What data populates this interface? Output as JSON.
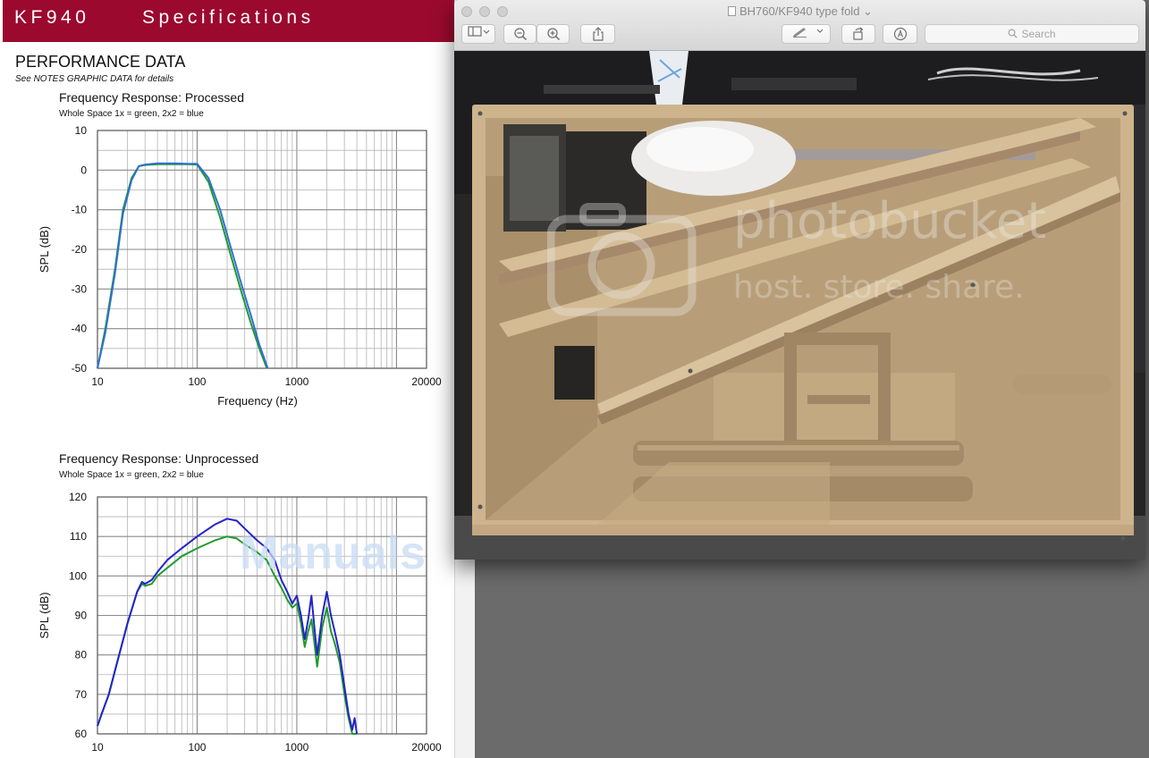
{
  "document": {
    "header": {
      "model": "KF940",
      "title": "Specifications"
    },
    "section_title": "PERFORMANCE DATA",
    "section_note": "See NOTES GRAPHIC DATA for details",
    "watermark": "Manuals"
  },
  "chart_data": [
    {
      "type": "line",
      "title": "Frequency Response: Processed",
      "subtitle": "Whole Space 1x = green, 2x2 = blue",
      "xlabel": "Frequency (Hz)",
      "ylabel": "SPL (dB)",
      "xscale": "log",
      "xlim": [
        10,
        20000
      ],
      "ylim": [
        -50,
        10
      ],
      "xticks": [
        "10",
        "100",
        "1000",
        "20000"
      ],
      "yticks": [
        "10",
        "0",
        "-10",
        "-20",
        "-30",
        "-40",
        "-50"
      ],
      "grid": true,
      "series": [
        {
          "color": "#1f9a2e",
          "x": [
            10,
            12,
            15,
            18,
            22,
            26,
            30,
            40,
            60,
            80,
            100,
            130,
            170,
            220,
            280,
            350,
            420,
            500
          ],
          "y": [
            -50,
            -40,
            -25,
            -10,
            -2,
            1,
            1.3,
            1.5,
            1.5,
            1.5,
            1.4,
            -3,
            -12,
            -22,
            -31,
            -39,
            -45,
            -50
          ]
        },
        {
          "color": "#2f6fd6",
          "x": [
            10,
            12,
            15,
            18,
            22,
            26,
            30,
            40,
            60,
            80,
            100,
            130,
            170,
            220,
            280,
            350,
            420,
            510
          ],
          "y": [
            -50,
            -41,
            -26,
            -11,
            -2.5,
            1,
            1.4,
            1.7,
            1.7,
            1.6,
            1.6,
            -2,
            -10,
            -20,
            -29,
            -37,
            -44,
            -50
          ]
        }
      ]
    },
    {
      "type": "line",
      "title": "Frequency Response: Unprocessed",
      "subtitle": "Whole Space 1x = green, 2x2 = blue",
      "xlabel": "",
      "ylabel": "SPL (dB)",
      "xscale": "log",
      "xlim": [
        10,
        20000
      ],
      "ylim": [
        60,
        120
      ],
      "xticks": [
        "10",
        "100",
        "1000",
        "20000"
      ],
      "yticks": [
        "120",
        "110",
        "100",
        "90",
        "80",
        "70",
        "60"
      ],
      "grid": true,
      "series": [
        {
          "color": "#1f9a2e",
          "x": [
            10,
            11,
            13,
            15,
            20,
            25,
            28,
            30,
            35,
            40,
            50,
            70,
            100,
            150,
            200,
            250,
            300,
            400,
            500,
            600,
            700,
            800,
            900,
            1000,
            1100,
            1200,
            1300,
            1400,
            1500,
            1600,
            1800,
            2000,
            2200,
            2400,
            2700,
            3000,
            3300,
            3600,
            4000
          ],
          "y": [
            62,
            65,
            70,
            76,
            88,
            96,
            98,
            97.5,
            98,
            100,
            102,
            105,
            107,
            109,
            110,
            109.5,
            108,
            106,
            104,
            100,
            97,
            94,
            92,
            93,
            88,
            82,
            86,
            89,
            83,
            77,
            87,
            92,
            86,
            83,
            78,
            70,
            64,
            60,
            60
          ]
        },
        {
          "color": "#2323c9",
          "x": [
            10,
            11,
            13,
            15,
            20,
            25,
            28,
            30,
            35,
            40,
            50,
            70,
            100,
            150,
            200,
            250,
            300,
            400,
            500,
            600,
            700,
            800,
            900,
            1000,
            1100,
            1200,
            1300,
            1400,
            1500,
            1600,
            1800,
            2000,
            2200,
            2400,
            2700,
            3000,
            3300,
            3600,
            3800,
            4000
          ],
          "y": [
            62,
            65,
            70,
            76,
            88,
            96,
            98.5,
            98,
            99,
            101,
            104,
            107,
            110,
            113,
            114.5,
            114,
            112,
            109,
            107,
            104,
            99,
            96,
            93,
            95,
            90,
            84,
            89,
            95,
            87,
            80,
            90,
            96,
            90,
            86,
            80,
            72,
            65,
            61,
            64,
            60
          ]
        }
      ]
    }
  ],
  "preview_window": {
    "title": "BH760/KF940 type fold",
    "title_chevron": "⌄",
    "toolbar": {
      "sidebar_icon": "sidebar-icon",
      "zoom_out_icon": "zoom-out-icon",
      "zoom_in_icon": "zoom-in-icon",
      "share_icon": "share-icon",
      "markup_icon": "pen-icon",
      "rotate_icon": "rotate-icon",
      "annotate_icon": "markup-circle-icon",
      "search_placeholder": "Search"
    },
    "image_watermark": {
      "brand": "photobucket",
      "tagline": "host. store. share."
    }
  }
}
